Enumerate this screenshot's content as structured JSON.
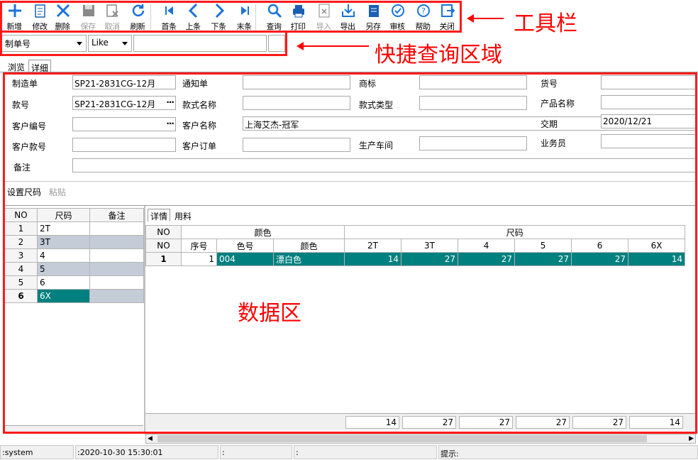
{
  "toolbar": {
    "items": [
      {
        "label": "新增",
        "name": "add-icon",
        "enabled": true
      },
      {
        "label": "修改",
        "name": "edit-icon",
        "enabled": true
      },
      {
        "label": "删除",
        "name": "delete-icon",
        "enabled": true
      },
      {
        "label": "保存",
        "name": "save-icon",
        "enabled": false
      },
      {
        "label": "取消",
        "name": "cancel-icon",
        "enabled": false
      },
      {
        "label": "刷新",
        "name": "refresh-icon",
        "enabled": true
      },
      {
        "label": "首条",
        "name": "first-icon",
        "enabled": true
      },
      {
        "label": "上条",
        "name": "prev-icon",
        "enabled": true
      },
      {
        "label": "下条",
        "name": "next-icon",
        "enabled": true
      },
      {
        "label": "末条",
        "name": "last-icon",
        "enabled": true
      },
      {
        "label": "查询",
        "name": "search-icon",
        "enabled": true
      },
      {
        "label": "打印",
        "name": "print-icon",
        "enabled": true
      },
      {
        "label": "导入",
        "name": "import-icon",
        "enabled": false
      },
      {
        "label": "导出",
        "name": "export-icon",
        "enabled": true
      },
      {
        "label": "另存",
        "name": "save-as-icon",
        "enabled": true
      },
      {
        "label": "审核",
        "name": "approve-icon",
        "enabled": true
      },
      {
        "label": "帮助",
        "name": "help-icon",
        "enabled": true
      },
      {
        "label": "关闭",
        "name": "close-icon",
        "enabled": true
      }
    ]
  },
  "query": {
    "field": "制单号",
    "operator": "Like",
    "value": ""
  },
  "tabs": {
    "browse": "浏览",
    "detail": "详细"
  },
  "form": {
    "manufacture_no_label": "制造单",
    "manufacture_no": "SP21-2831CG-12月",
    "notice_label": "通知单",
    "notice": "",
    "brand_label": "商标",
    "brand": "",
    "item_no_label": "货号",
    "item_no": "",
    "style_no_label": "款号",
    "style_no": "SP21-2831CG-12月",
    "style_name_label": "款式名称",
    "style_name": "",
    "style_type_label": "款式类型",
    "style_type": "",
    "product_name_label": "产品名称",
    "product_name": "",
    "customer_code_label": "客户编号",
    "customer_code": "",
    "customer_name_label": "客户名称",
    "customer_name": "上海艾杰-冠军",
    "delivery_label": "交期",
    "delivery": "2020/12/21",
    "customer_style_label": "客户款号",
    "customer_style": "",
    "customer_order_label": "客户订单",
    "customer_order": "",
    "workshop_label": "生产车间",
    "workshop": "",
    "salesman_label": "业务员",
    "salesman": "",
    "remark_label": "备注",
    "remark": ""
  },
  "size_actions": {
    "set_size": "设置尺码",
    "paste": "粘贴"
  },
  "size_table": {
    "headers": [
      "NO",
      "尺码",
      "备注"
    ],
    "rows": [
      [
        "1",
        "2T",
        ""
      ],
      [
        "2",
        "3T",
        ""
      ],
      [
        "3",
        "4",
        ""
      ],
      [
        "4",
        "5",
        ""
      ],
      [
        "5",
        "6",
        ""
      ],
      [
        "6",
        "6X",
        ""
      ]
    ]
  },
  "detail_tabs": {
    "detail": "详情",
    "material": "用料"
  },
  "detail_table": {
    "group_headers": {
      "no": "NO",
      "color": "颜色",
      "size": "尺码"
    },
    "headers": [
      "NO",
      "序号",
      "色号",
      "颜色",
      "2T",
      "3T",
      "4",
      "5",
      "6",
      "6X"
    ],
    "rows": [
      [
        "1",
        "1",
        "004",
        "漂白色",
        "14",
        "27",
        "27",
        "27",
        "27",
        "14"
      ]
    ],
    "totals": [
      "14",
      "27",
      "27",
      "27",
      "27",
      "14"
    ]
  },
  "annotations": {
    "toolbar": "工具栏",
    "quick_query": "快捷查询区域",
    "data_area": "数据区"
  },
  "status": {
    "user": ":system",
    "time": ":2020-10-30 15:30:01",
    "s3": ":",
    "s4": ":",
    "hint": "提示:"
  },
  "colors": {
    "teal": "#00807f",
    "grey_row": "#c3ccd7",
    "annotation": "#ff0000"
  }
}
